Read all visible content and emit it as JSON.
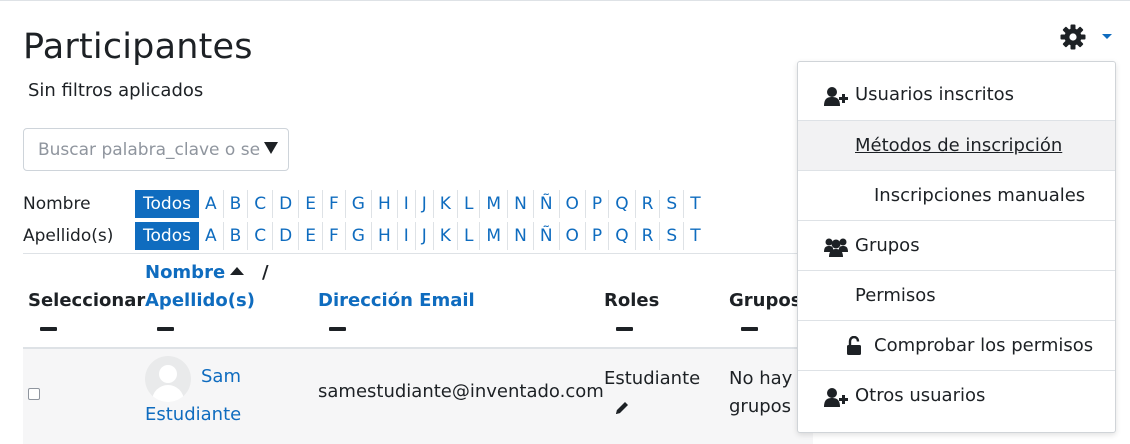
{
  "page": {
    "title": "Participantes",
    "filters_status": "Sin filtros aplicados"
  },
  "search": {
    "placeholder": "Buscar palabra_clave o selec"
  },
  "initials": {
    "first_name_label": "Nombre",
    "last_name_label": "Apellido(s)",
    "all_label": "Todos",
    "letters": [
      "A",
      "B",
      "C",
      "D",
      "E",
      "F",
      "G",
      "H",
      "I",
      "J",
      "K",
      "L",
      "M",
      "N",
      "Ñ",
      "O",
      "P",
      "Q",
      "R",
      "S",
      "T"
    ]
  },
  "table": {
    "headers": {
      "select": "Seleccionar",
      "first_name": "Nombre",
      "separator": "/",
      "last_name": "Apellido(s)",
      "email": "Dirección Email",
      "roles": "Roles",
      "groups": "Grupos"
    },
    "rows": [
      {
        "first_name": "Sam",
        "last_name": "Estudiante",
        "email": "samestudiante@inventado.com",
        "role": "Estudiante",
        "groups_line1": "No hay",
        "groups_line2": "grupos"
      }
    ]
  },
  "menu": {
    "items": [
      {
        "label": "Usuarios inscritos",
        "icon": "user-plus-icon"
      },
      {
        "label": "Métodos de inscripción",
        "icon": ""
      },
      {
        "label": "Inscripciones manuales",
        "icon": ""
      },
      {
        "label": "Grupos",
        "icon": "users-icon"
      },
      {
        "label": "Permisos",
        "icon": ""
      },
      {
        "label": "Comprobar los permisos",
        "icon": "unlock-icon"
      },
      {
        "label": "Otros usuarios",
        "icon": "user-plus-icon"
      }
    ]
  },
  "colors": {
    "link": "#0f6cbf",
    "text": "#1d2125",
    "row_bg": "#f6f6f7"
  }
}
